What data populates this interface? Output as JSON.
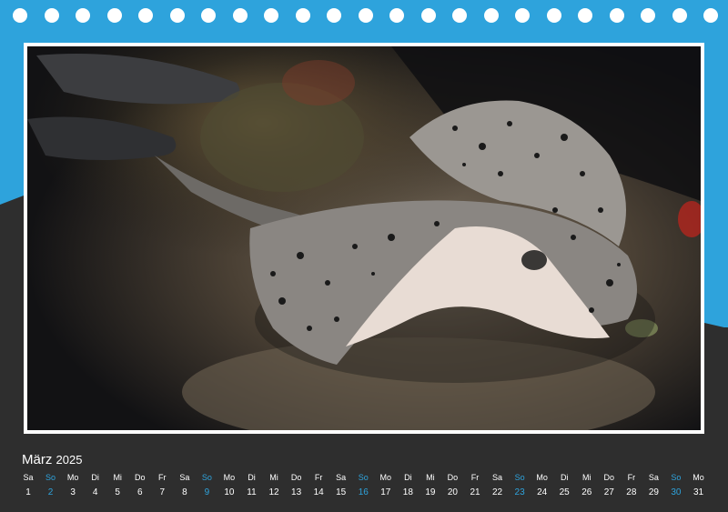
{
  "colors": {
    "accent": "#2ea3dc",
    "background_dark": "#2e2e2e",
    "text": "#ffffff"
  },
  "photo": {
    "subject_icon": "stingray-photo-icon"
  },
  "calendar": {
    "month": "März",
    "year": "2025",
    "weekday_labels": [
      "Sa",
      "So",
      "Mo",
      "Di",
      "Mi",
      "Do",
      "Fr",
      "Sa",
      "So",
      "Mo",
      "Di",
      "Mi",
      "Do",
      "Fr",
      "Sa",
      "So",
      "Mo",
      "Di",
      "Mi",
      "Do",
      "Fr",
      "Sa",
      "So",
      "Mo",
      "Di",
      "Mi",
      "Do",
      "Fr",
      "Sa",
      "So",
      "Mo"
    ],
    "days": [
      "1",
      "2",
      "3",
      "4",
      "5",
      "6",
      "7",
      "8",
      "9",
      "10",
      "11",
      "12",
      "13",
      "14",
      "15",
      "16",
      "17",
      "18",
      "19",
      "20",
      "21",
      "22",
      "23",
      "24",
      "25",
      "26",
      "27",
      "28",
      "29",
      "30",
      "31"
    ],
    "sunday_days": [
      "2",
      "9",
      "16",
      "23",
      "30"
    ]
  }
}
